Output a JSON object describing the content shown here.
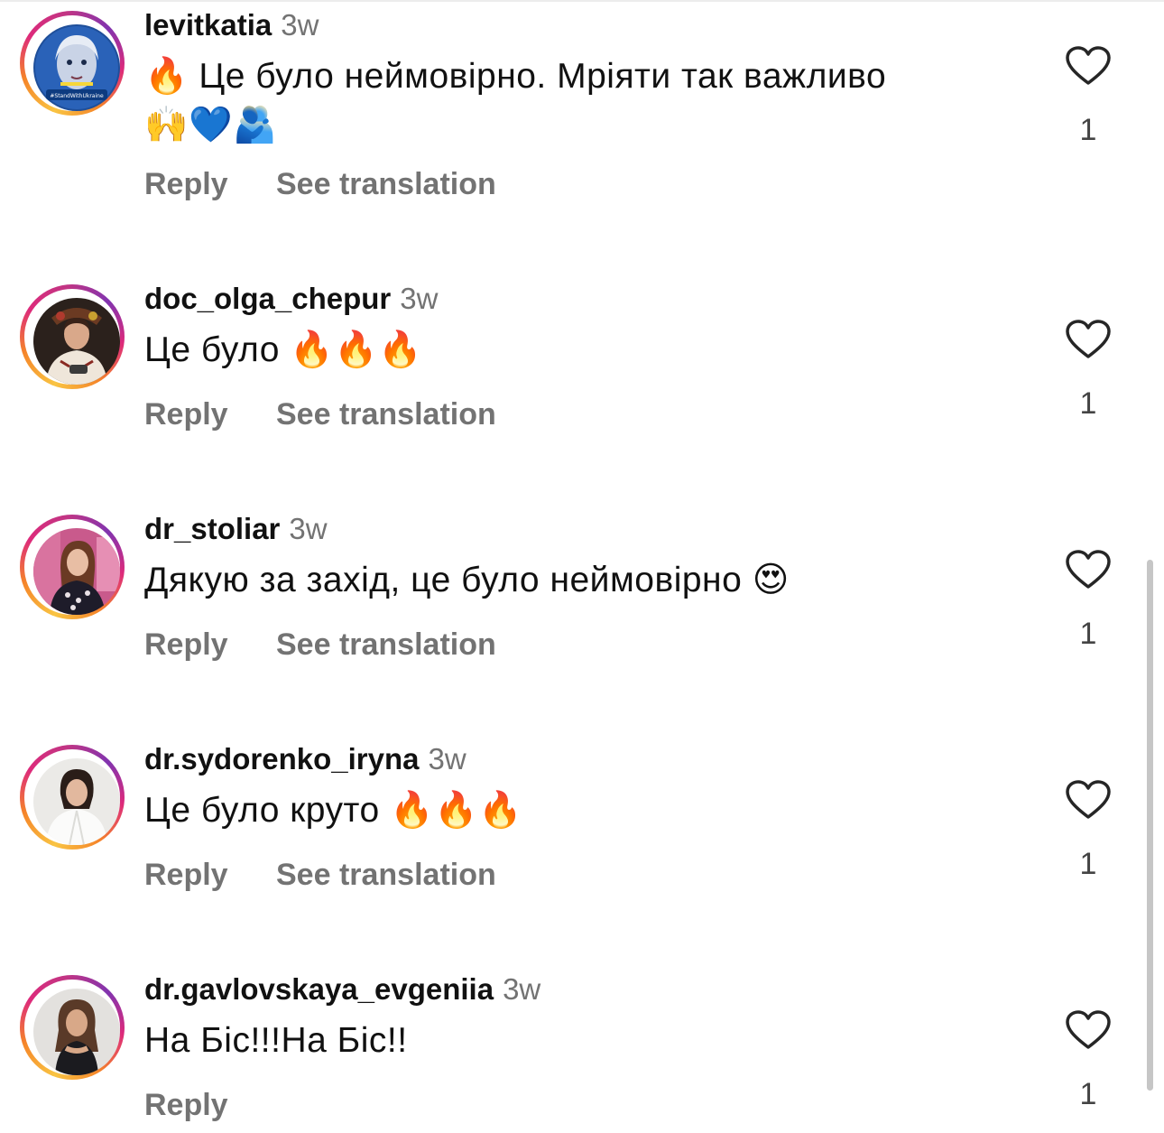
{
  "comments": [
    {
      "username": "levitkatia",
      "time": "3w",
      "text_line1": "🔥 Це було неймовірно. Мріяти так важливо",
      "text_line2": "🙌💙🫂",
      "reply_label": "Reply",
      "translate_label": "See translation",
      "likes": "1"
    },
    {
      "username": "doc_olga_chepur",
      "time": "3w",
      "text_line1": "Це було 🔥🔥🔥",
      "reply_label": "Reply",
      "translate_label": "See translation",
      "likes": "1"
    },
    {
      "username": "dr_stoliar",
      "time": "3w",
      "text_line1": "Дякую за захід, це було неймовірно 😍",
      "reply_label": "Reply",
      "translate_label": "See translation",
      "likes": "1"
    },
    {
      "username": "dr.sydorenko_iryna",
      "time": "3w",
      "text_line1": "Це було круто 🔥🔥🔥",
      "reply_label": "Reply",
      "translate_label": "See translation",
      "likes": "1"
    },
    {
      "username": "dr.gavlovskaya_evgeniia",
      "time": "3w",
      "text_line1": "На Біс!!!На Біс!!",
      "reply_label": "Reply",
      "likes": "1"
    }
  ],
  "avatar_badge_text": "#StandWithUkraine",
  "colors": {
    "text": "#111111",
    "secondary": "#737373",
    "heart_stroke": "#262626"
  },
  "icons": [
    "heart-outline-icon",
    "avatar-story-ring"
  ]
}
